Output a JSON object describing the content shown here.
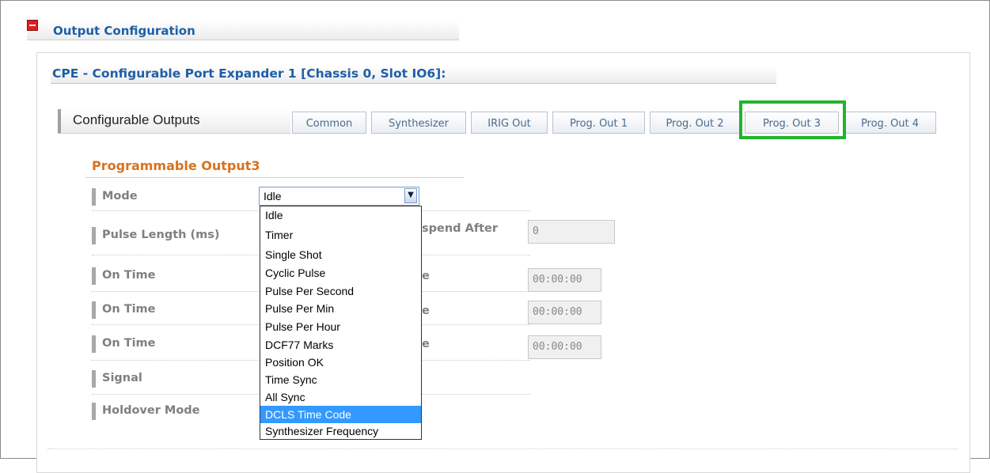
{
  "section": {
    "title": "Output Configuration",
    "icon": "collapse-icon"
  },
  "device": {
    "title": "CPE - Configurable Port Expander 1 [Chassis 0, Slot IO6]:"
  },
  "tabs_label": "Configurable Outputs",
  "tabs": [
    {
      "label": "Common"
    },
    {
      "label": "Synthesizer"
    },
    {
      "label": "IRIG Out"
    },
    {
      "label": "Prog. Out 1"
    },
    {
      "label": "Prog. Out 2"
    },
    {
      "label": "Prog. Out 3",
      "active": true
    },
    {
      "label": "Prog. Out 4"
    }
  ],
  "highlight_color": "#21b42a",
  "programmable": {
    "title": "Programmable Output3",
    "rows": [
      {
        "label": "Mode"
      },
      {
        "label": "Pulse Length (ms)",
        "right_label": "spend After",
        "value": "0"
      },
      {
        "label": "On Time",
        "right_label": "e",
        "value": "00:00:00"
      },
      {
        "label": "On Time",
        "right_label": "e",
        "value": "00:00:00"
      },
      {
        "label": "On Time",
        "right_label": "e",
        "value": "00:00:00"
      },
      {
        "label": "Signal"
      },
      {
        "label": "Holdover Mode"
      }
    ]
  },
  "mode_select": {
    "value": "Idle",
    "options": [
      "Idle",
      "Timer",
      "Single Shot",
      "Cyclic Pulse",
      "Pulse Per Second",
      "Pulse Per Min",
      "Pulse Per Hour",
      "DCF77 Marks",
      "Position OK",
      "Time Sync",
      "All Sync",
      "DCLS Time Code",
      "Synthesizer Frequency"
    ],
    "highlighted": "DCLS Time Code"
  }
}
